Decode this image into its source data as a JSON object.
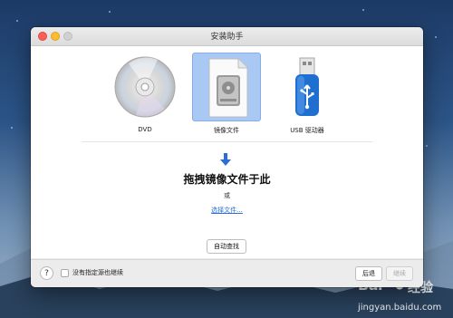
{
  "window": {
    "title": "安装助手"
  },
  "sources": [
    {
      "label": "DVD",
      "icon": "dvd-disc-icon",
      "selected": false
    },
    {
      "label": "镜像文件",
      "icon": "disk-image-file-icon",
      "selected": true
    },
    {
      "label": "USB 驱动器",
      "icon": "usb-drive-icon",
      "selected": false
    }
  ],
  "drop_area": {
    "arrow_icon": "arrow-down-icon",
    "text": "拖拽镜像文件于此",
    "or": "或",
    "choose_link": "选择文件..."
  },
  "auto_find_label": "自动查找",
  "footer": {
    "help_label": "?",
    "checkbox_label": "没有指定源也继续",
    "back_label": "后退",
    "next_label": "继续"
  },
  "watermark": {
    "logo": "Bai",
    "text": "经验",
    "url": "jingyan.baidu.com"
  },
  "colors": {
    "selected_tile": "#a9c8f3",
    "arrow": "#2b6fd3",
    "link": "#2b6fd3",
    "usb_body": "#1f6fd1"
  }
}
